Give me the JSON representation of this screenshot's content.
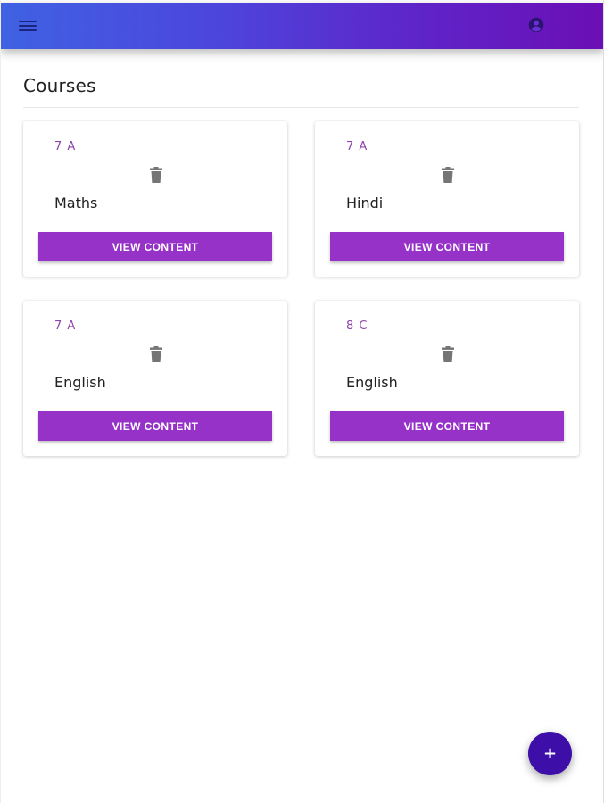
{
  "header": {
    "menu_icon": "hamburger-menu-icon",
    "account_icon": "account-circle-icon",
    "gradient_start": "#3f62e3",
    "gradient_end": "#6a0fb5"
  },
  "page": {
    "title": "Courses"
  },
  "courses": [
    {
      "class_label": "7 A",
      "subject": "Maths",
      "delete_icon": "trash-icon",
      "button_label": "VIEW CONTENT"
    },
    {
      "class_label": "7 A",
      "subject": "Hindi",
      "delete_icon": "trash-icon",
      "button_label": "VIEW CONTENT"
    },
    {
      "class_label": "7 A",
      "subject": "English",
      "delete_icon": "trash-icon",
      "button_label": "VIEW CONTENT"
    },
    {
      "class_label": "8 C",
      "subject": "English",
      "delete_icon": "trash-icon",
      "button_label": "VIEW CONTENT"
    }
  ],
  "fab": {
    "label": "+",
    "icon": "plus-icon",
    "color": "#3e0fa8"
  },
  "colors": {
    "accent": "#9632c8",
    "class_label": "#8e44ad"
  }
}
